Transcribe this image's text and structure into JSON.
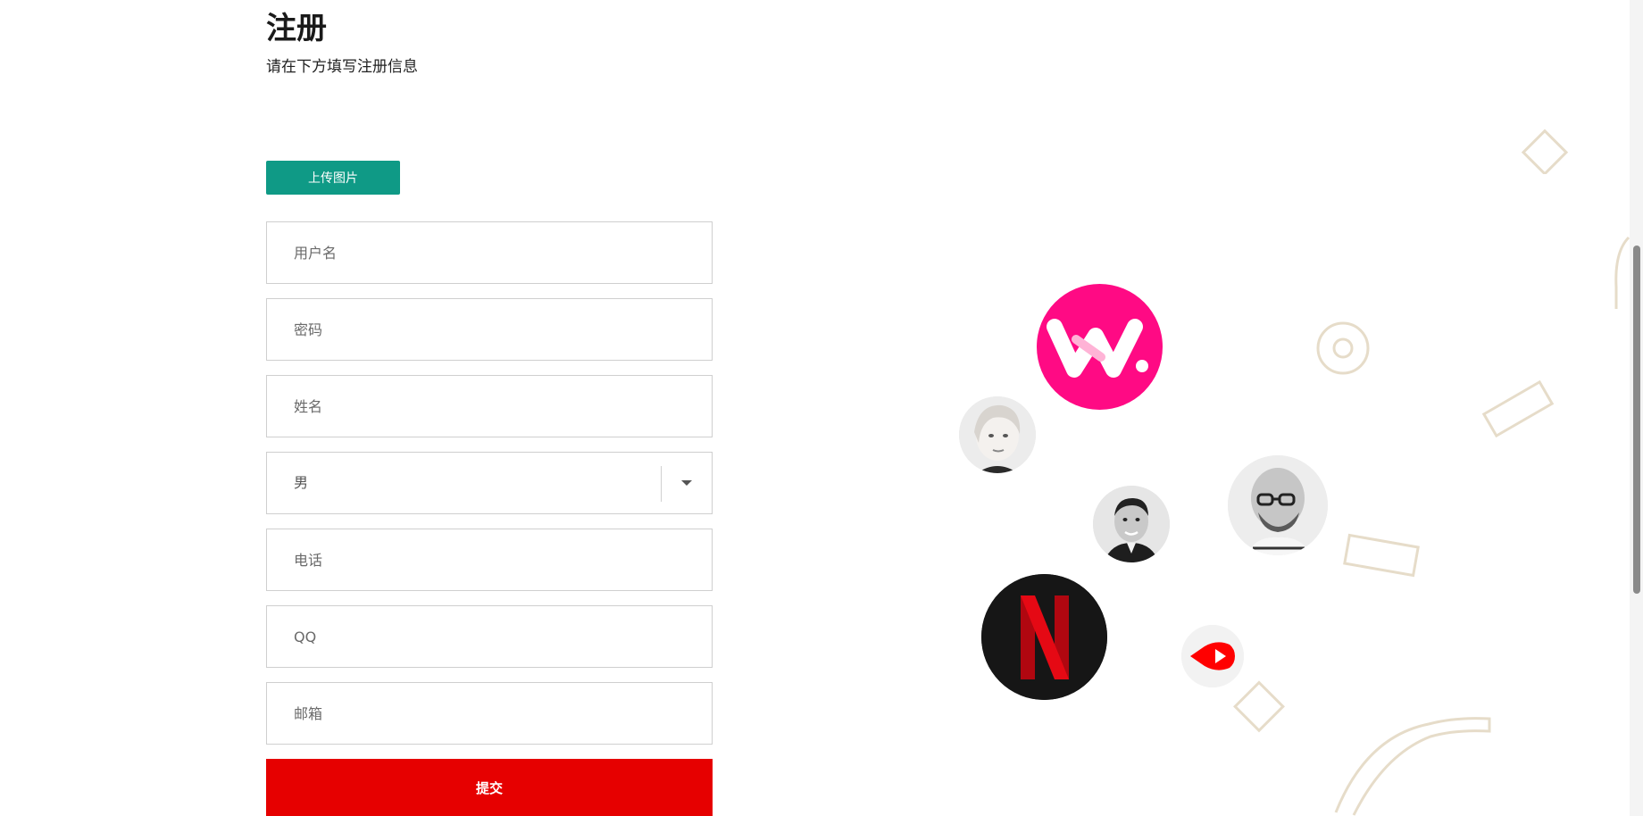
{
  "form": {
    "title": "注册",
    "subtitle": "请在下方填写注册信息",
    "upload_label": "上传图片",
    "fields": {
      "username": {
        "placeholder": "用户名",
        "value": ""
      },
      "password": {
        "placeholder": "密码",
        "value": ""
      },
      "name": {
        "placeholder": "姓名",
        "value": ""
      },
      "gender": {
        "selected": "男"
      },
      "phone": {
        "placeholder": "电话",
        "value": ""
      },
      "qq": {
        "placeholder": "QQ",
        "value": ""
      },
      "email": {
        "placeholder": "邮箱",
        "value": ""
      }
    },
    "submit_label": "提交"
  },
  "colors": {
    "upload_button": "#0f9a86",
    "submit_button": "#e60000",
    "brand_w": "#ff0a84",
    "netflix_red": "#e50914",
    "youtube_red": "#ff0000",
    "decoration": "#e6dcc9"
  },
  "illustration": {
    "bubbles": [
      {
        "icon": "w-logo-icon"
      },
      {
        "icon": "woman-avatar-icon"
      },
      {
        "icon": "man-avatar-icon"
      },
      {
        "icon": "bald-man-avatar-icon"
      },
      {
        "icon": "netflix-logo-icon"
      },
      {
        "icon": "youtube-play-icon"
      }
    ]
  }
}
